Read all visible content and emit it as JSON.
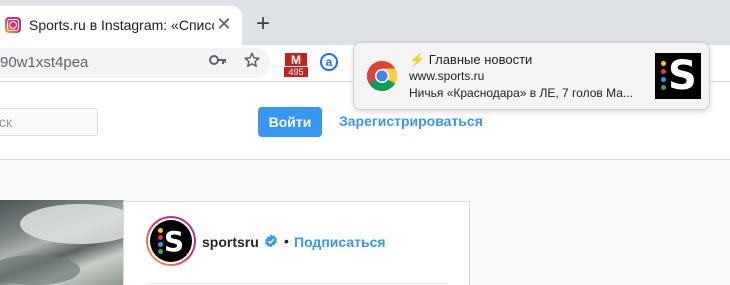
{
  "browser": {
    "tab": {
      "title": "Sports.ru в Instagram: «Список",
      "close_glyph": "✕"
    },
    "new_tab_glyph": "+",
    "omnibox": {
      "url": "90w1xst4pea"
    },
    "extensions": {
      "gmail_letter": "M",
      "gmail_count": "495",
      "extension_letter": "a"
    }
  },
  "page": {
    "search_placeholder": "ск",
    "login_label": "Войти",
    "register_label": "Зарегистрироваться",
    "post": {
      "username": "sportsru",
      "separator": "•",
      "follow_label": "Подписаться",
      "avatar_letter": "S"
    }
  },
  "notification": {
    "title": "⚡️ Главные новости",
    "source": "www.sports.ru",
    "body": "Ничья «Краснодара» в ЛЕ, 7 голов Ма...",
    "image_letter": "S"
  },
  "colors": {
    "accent_blue": "#3897f0",
    "gmail_red": "#c5221f",
    "verified_blue": "#3897f0"
  }
}
